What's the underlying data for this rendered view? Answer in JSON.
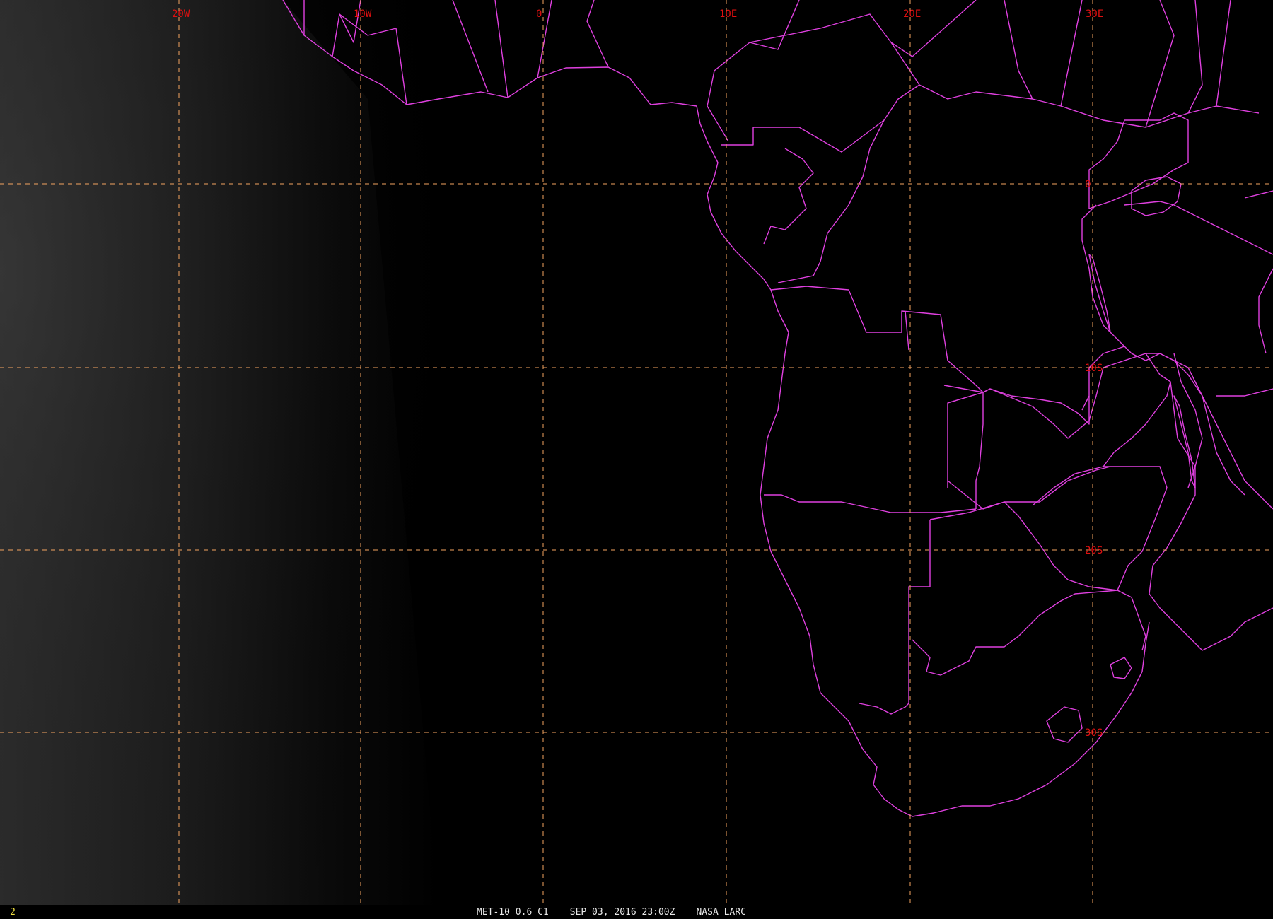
{
  "colors": {
    "background": "#000000",
    "grid": "#f4a460",
    "boundaries": "#e040e0",
    "grid_labels": "#e01010",
    "frame_number": "#f0e040"
  },
  "grid": {
    "longitude_labels": [
      "20W",
      "10W",
      "0",
      "10E",
      "20E",
      "30E"
    ],
    "latitude_labels": [
      "0",
      "10S",
      "20S",
      "30S"
    ]
  },
  "status": {
    "frame_number": "2",
    "satellite_channel": "MET-10 0.6 C1",
    "datetime": "SEP 03, 2016 23:00Z",
    "agency": "NASA LARC"
  }
}
